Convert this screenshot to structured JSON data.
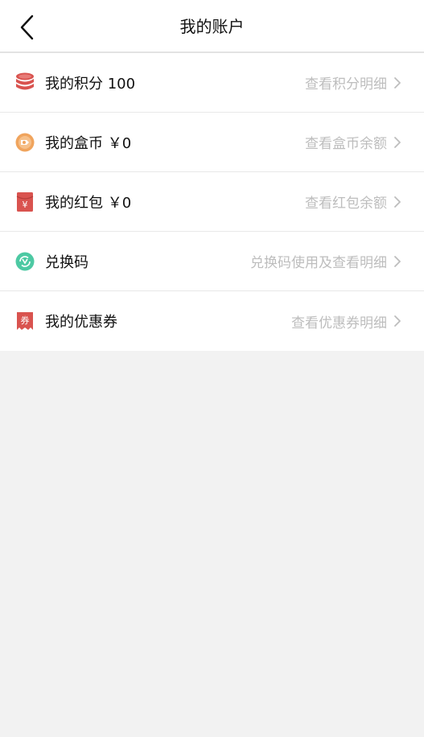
{
  "header": {
    "title": "我的账户"
  },
  "rows": [
    {
      "label": "我的积分 100",
      "detail": "查看积分明细",
      "icon": "points-coins-icon",
      "color": "#d9534f"
    },
    {
      "label": "我的盒币 ￥0",
      "detail": "查看盒币余额",
      "icon": "box-coin-icon",
      "color": "#f0a45d"
    },
    {
      "label": "我的红包 ￥0",
      "detail": "查看红包余额",
      "icon": "red-envelope-icon",
      "color": "#d9534f"
    },
    {
      "label": "兑换码",
      "detail": "兑换码使用及查看明细",
      "icon": "redeem-code-icon",
      "color": "#4dc9a3"
    },
    {
      "label": "我的优惠券",
      "detail": "查看优惠券明细",
      "icon": "coupon-icon",
      "color": "#d9534f",
      "icon_text": "券"
    }
  ]
}
